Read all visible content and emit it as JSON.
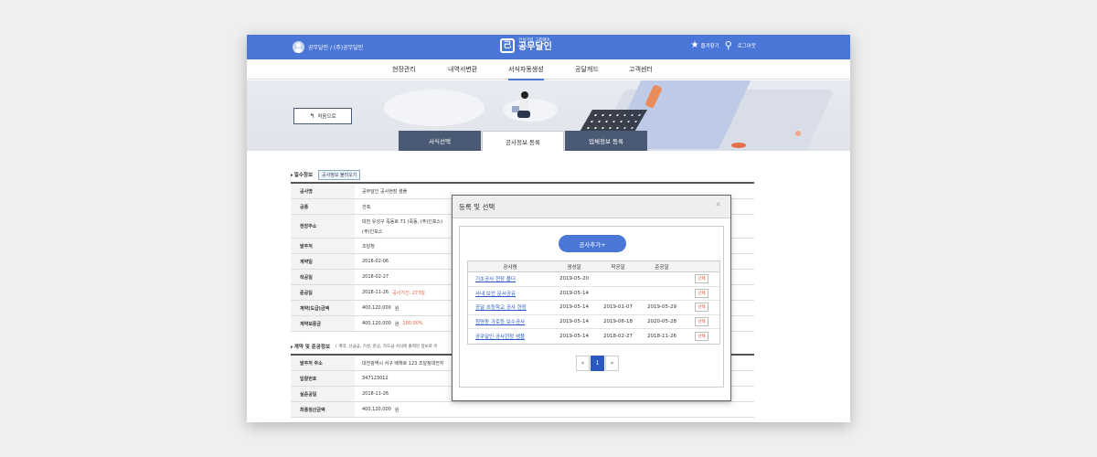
{
  "header": {
    "user_name": "공무달인 / (주)공무달인",
    "logo_subtitle": "건설기업 그룹웨어",
    "logo_title": "공무달인",
    "bookmark_label": "즐겨찾기",
    "logout_label": "로그아웃",
    "brand_color": "#4a76d8"
  },
  "nav": {
    "items": [
      "현장관리",
      "내역서변환",
      "서식자동생성",
      "공달캐드",
      "고객센터"
    ],
    "active": "서식자동생성"
  },
  "hero": {
    "back_label": "처음으로"
  },
  "tabs": [
    {
      "label": "서식선택",
      "active": false
    },
    {
      "label": "공사정보 등록",
      "active": true
    },
    {
      "label": "업체정보 등록",
      "active": false
    }
  ],
  "form": {
    "section1_title": "필수정보",
    "load_button": "공사정보 불러오기",
    "rows": [
      {
        "key": "공사명",
        "value": "공무달인 공사현장 샘플"
      },
      {
        "key": "공종",
        "value": "건축"
      },
      {
        "key": "현장주소",
        "value": "대전 유성구 죽동로 71 (죽동, (주)인포스)",
        "value2": "(주)인포스"
      },
      {
        "key": "발주처",
        "value": "조달청"
      },
      {
        "key": "계약일",
        "value": "2018-02-06"
      },
      {
        "key": "착공일",
        "value": "2018-02-27"
      },
      {
        "key": "준공일",
        "value": "2018-11-26",
        "note": "공사기간: 273일"
      },
      {
        "key": "계약(도급)금액",
        "value": "400,120,000",
        "unit": "원"
      },
      {
        "key": "계약보증금",
        "value": "400,120,000",
        "unit": "원",
        "note": "100.00%"
      }
    ],
    "section2_title": "계약 및 준공정보",
    "section2_note": "( 계약, 선급금, 기성, 준공, 하도급 서식에 출력된 정보로 이",
    "rows2": [
      {
        "key": "발주처 주소",
        "value": "대전광역시 서구 배재로 123 조달청대전지"
      },
      {
        "key": "입찰번호",
        "value": "347123012"
      },
      {
        "key": "실준공일",
        "value": "2018-11-26"
      },
      {
        "key": "최종정산금액",
        "value": "400,120,000",
        "unit": "원"
      }
    ]
  },
  "modal": {
    "title": "등록 및 선택",
    "close": "×",
    "add_button": "공사추가+",
    "columns": [
      "공사명",
      "생성일",
      "착공일",
      "준공일"
    ],
    "select_label": "선택",
    "rows": [
      {
        "name": "기초공사 현장 폴더",
        "created": "2019-05-20",
        "start": "",
        "end": ""
      },
      {
        "name": "사내 보안 문서공유",
        "created": "2019-05-14",
        "start": "",
        "end": ""
      },
      {
        "name": "공달 초등학교 공사 현장",
        "created": "2019-05-14",
        "start": "2019-01-07",
        "end": "2019-05-29"
      },
      {
        "name": "청명동 가로등 보수공사",
        "created": "2019-05-14",
        "start": "2019-06-18",
        "end": "2020-05-28"
      },
      {
        "name": "공무달인 공사현장 샘플",
        "created": "2019-05-14",
        "start": "2018-02-27",
        "end": "2018-11-26"
      }
    ],
    "pagination": {
      "prev": "«",
      "current": "1",
      "next": "»"
    }
  }
}
